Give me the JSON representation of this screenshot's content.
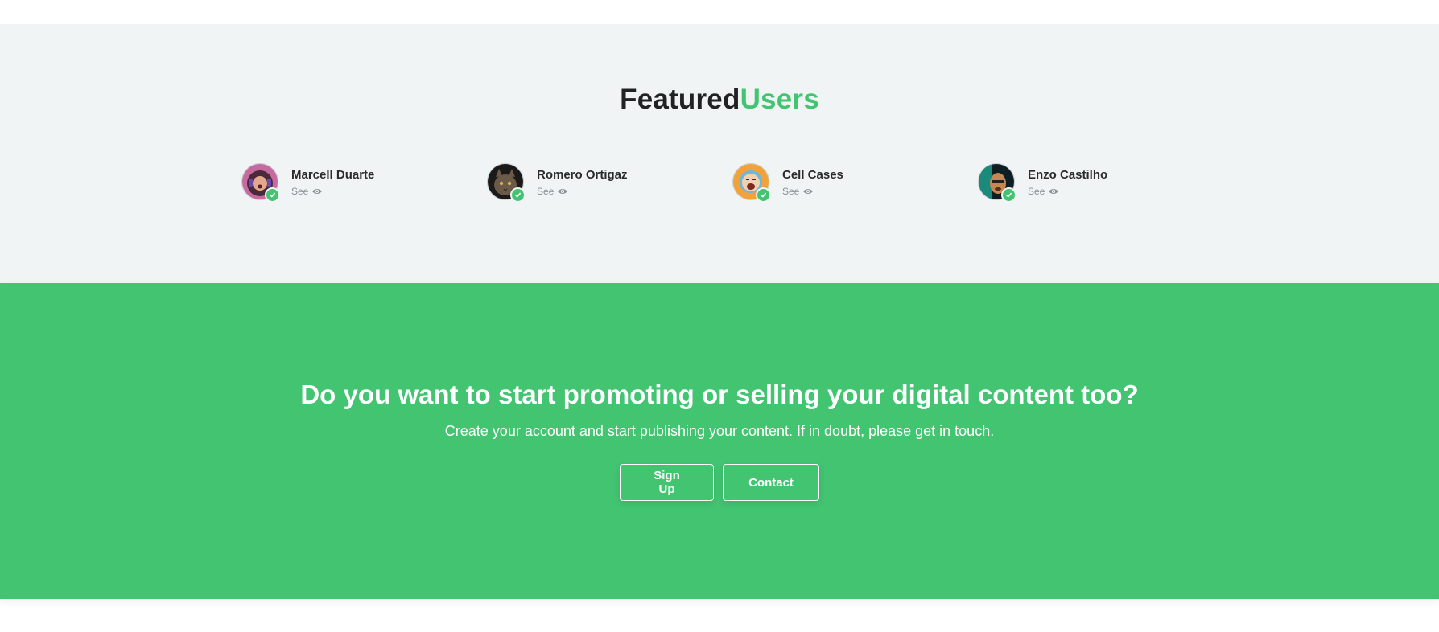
{
  "featured": {
    "title_main": "Featured",
    "title_accent": "Users",
    "accent_color": "#42c471",
    "users": [
      {
        "name": "Marcell Duarte",
        "see_label": "See",
        "avatar": "woman-headphones-avatar"
      },
      {
        "name": "Romero Ortigaz",
        "see_label": "See",
        "avatar": "cat-avatar"
      },
      {
        "name": "Cell Cases",
        "see_label": "See",
        "avatar": "laughing-man-avatar"
      },
      {
        "name": "Enzo Castilho",
        "see_label": "See",
        "avatar": "neon-portrait-avatar"
      }
    ]
  },
  "cta": {
    "title": "Do you want to start promoting or selling your digital content too?",
    "subtitle": "Create your account and start publishing your content. If in doubt, please get in touch.",
    "signup_label": "Sign Up",
    "contact_label": "Contact",
    "background_color": "#42c471"
  }
}
